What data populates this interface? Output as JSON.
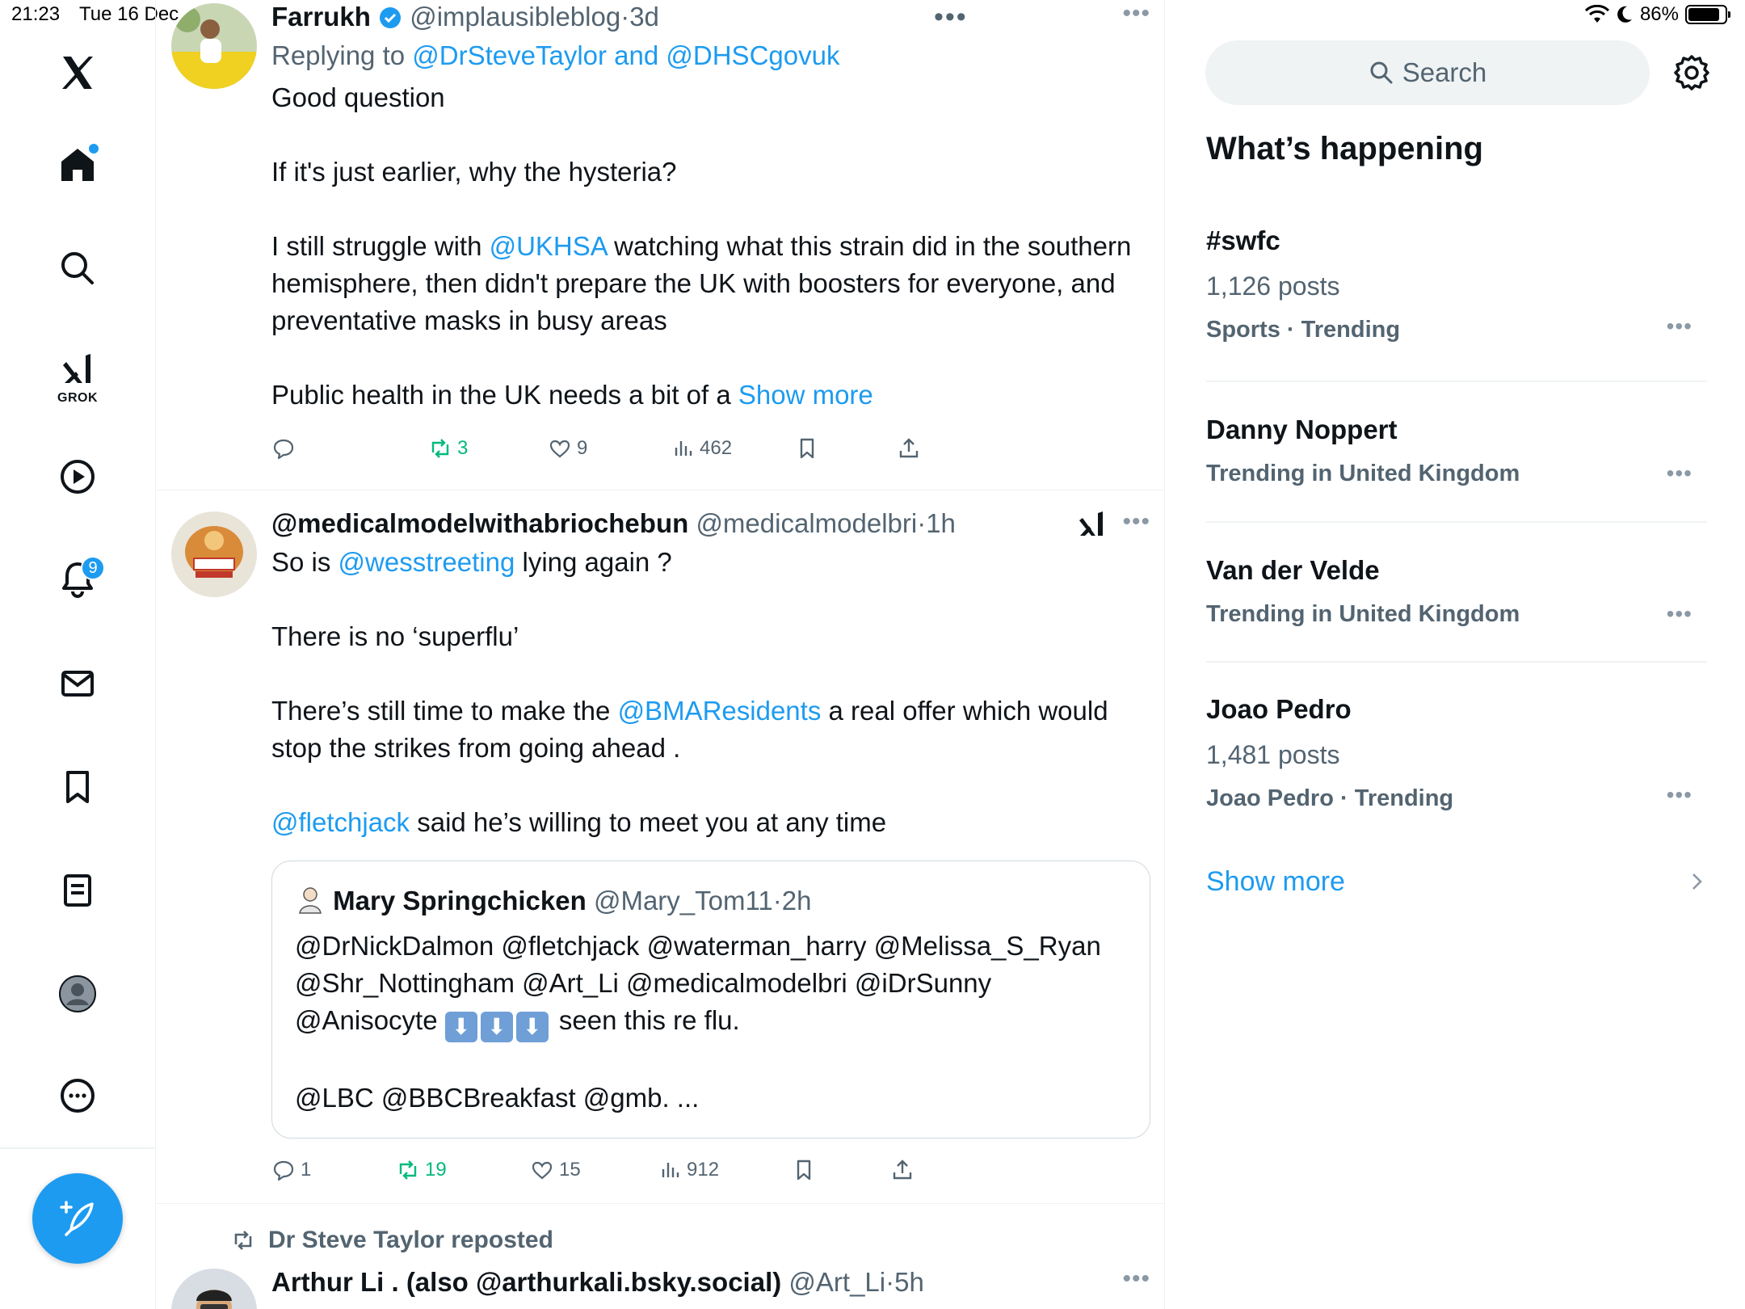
{
  "status_bar": {
    "time": "21:23",
    "date": "Tue 16 Dec",
    "battery": "86%",
    "battery_level": 0.86
  },
  "nav": {
    "notifications_badge": "9",
    "grok_label": "GROK"
  },
  "tweets": [
    {
      "name": "Farrukh",
      "handle": "@implausibleblog",
      "sep": "·",
      "time": "3d",
      "replying_prefix": "Replying to ",
      "replying_to": "@DrSteveTaylor and @DHSCgovuk",
      "p1": "Good question",
      "p2": "If it's just earlier, why the hysteria?",
      "p3_a": "I still struggle with ",
      "p3_link": "@UKHSA",
      "p3_b": " watching what this strain did in the southern hemisphere, then didn't prepare the UK with boosters for everyone, and preventative masks in busy areas",
      "p4_a": "Public health in the UK needs a bit of a ",
      "show_more": "Show more",
      "stats": {
        "reposts": "3",
        "likes": "9",
        "views": "462"
      }
    },
    {
      "name": "@medicalmodelwithabriochebun",
      "handle": "@medicalmodelbri",
      "sep": "·",
      "time": "1h",
      "p1_a": "So is ",
      "p1_link": "@wesstreeting",
      "p1_b": " lying again ?",
      "p2": "There is no ‘superflu’",
      "p3_a": "There’s still time to make the ",
      "p3_link": "@BMAResidents",
      "p3_b": " a real offer which would stop the strikes from going ahead .",
      "p4_link": "@fletchjack",
      "p4_b": " said he’s willing to meet you at any time",
      "quote": {
        "name": "Mary Springchicken",
        "handle": "@Mary_Tom11",
        "sep": "·",
        "time": "2h",
        "line1": "@DrNickDalmon @fletchjack @waterman_harry @Melissa_S_Ryan @Shr_Nottingham @Art_Li @medicalmodelbri @iDrSunny @Anisocyte ",
        "emoji": "⬇",
        "line1_end": " seen this re flu.",
        "line2": "@LBC @BBCBreakfast @gmb. ..."
      },
      "stats": {
        "replies": "1",
        "reposts": "19",
        "likes": "15",
        "views": "912"
      }
    },
    {
      "repost_label": "Dr Steve Taylor reposted",
      "name": "Arthur Li . (also @arthurkali.bsky.social)",
      "handle": "@Art_Li",
      "sep": "·",
      "time": "5h"
    }
  ],
  "sidebar": {
    "search_placeholder": "Search",
    "title": "What’s happening",
    "trends": [
      {
        "name": "#swfc",
        "posts": "1,126 posts",
        "category": "Sports · Trending"
      },
      {
        "name": "Danny Noppert",
        "posts": "",
        "category": "Trending in United Kingdom"
      },
      {
        "name": "Van der Velde",
        "posts": "",
        "category": "Trending in United Kingdom"
      },
      {
        "name": "Joao Pedro",
        "posts": "1,481 posts",
        "category": "Joao Pedro · Trending"
      }
    ],
    "show_more": "Show more"
  },
  "colors": {
    "accent": "#1d9bf0",
    "repost_green": "#00ba7c",
    "secondary_text": "#536471"
  },
  "icons": [
    "x-logo-icon",
    "home-icon",
    "search-icon",
    "grok-icon",
    "video-icon",
    "bell-icon",
    "mail-icon",
    "bookmark-icon",
    "lists-icon",
    "profile-icon",
    "more-icon",
    "compose-icon",
    "reply-icon",
    "repost-icon",
    "like-icon",
    "views-icon",
    "share-icon",
    "gear-icon",
    "chevron-right-icon",
    "verified-icon",
    "wifi-icon",
    "moon-icon",
    "battery-icon"
  ]
}
